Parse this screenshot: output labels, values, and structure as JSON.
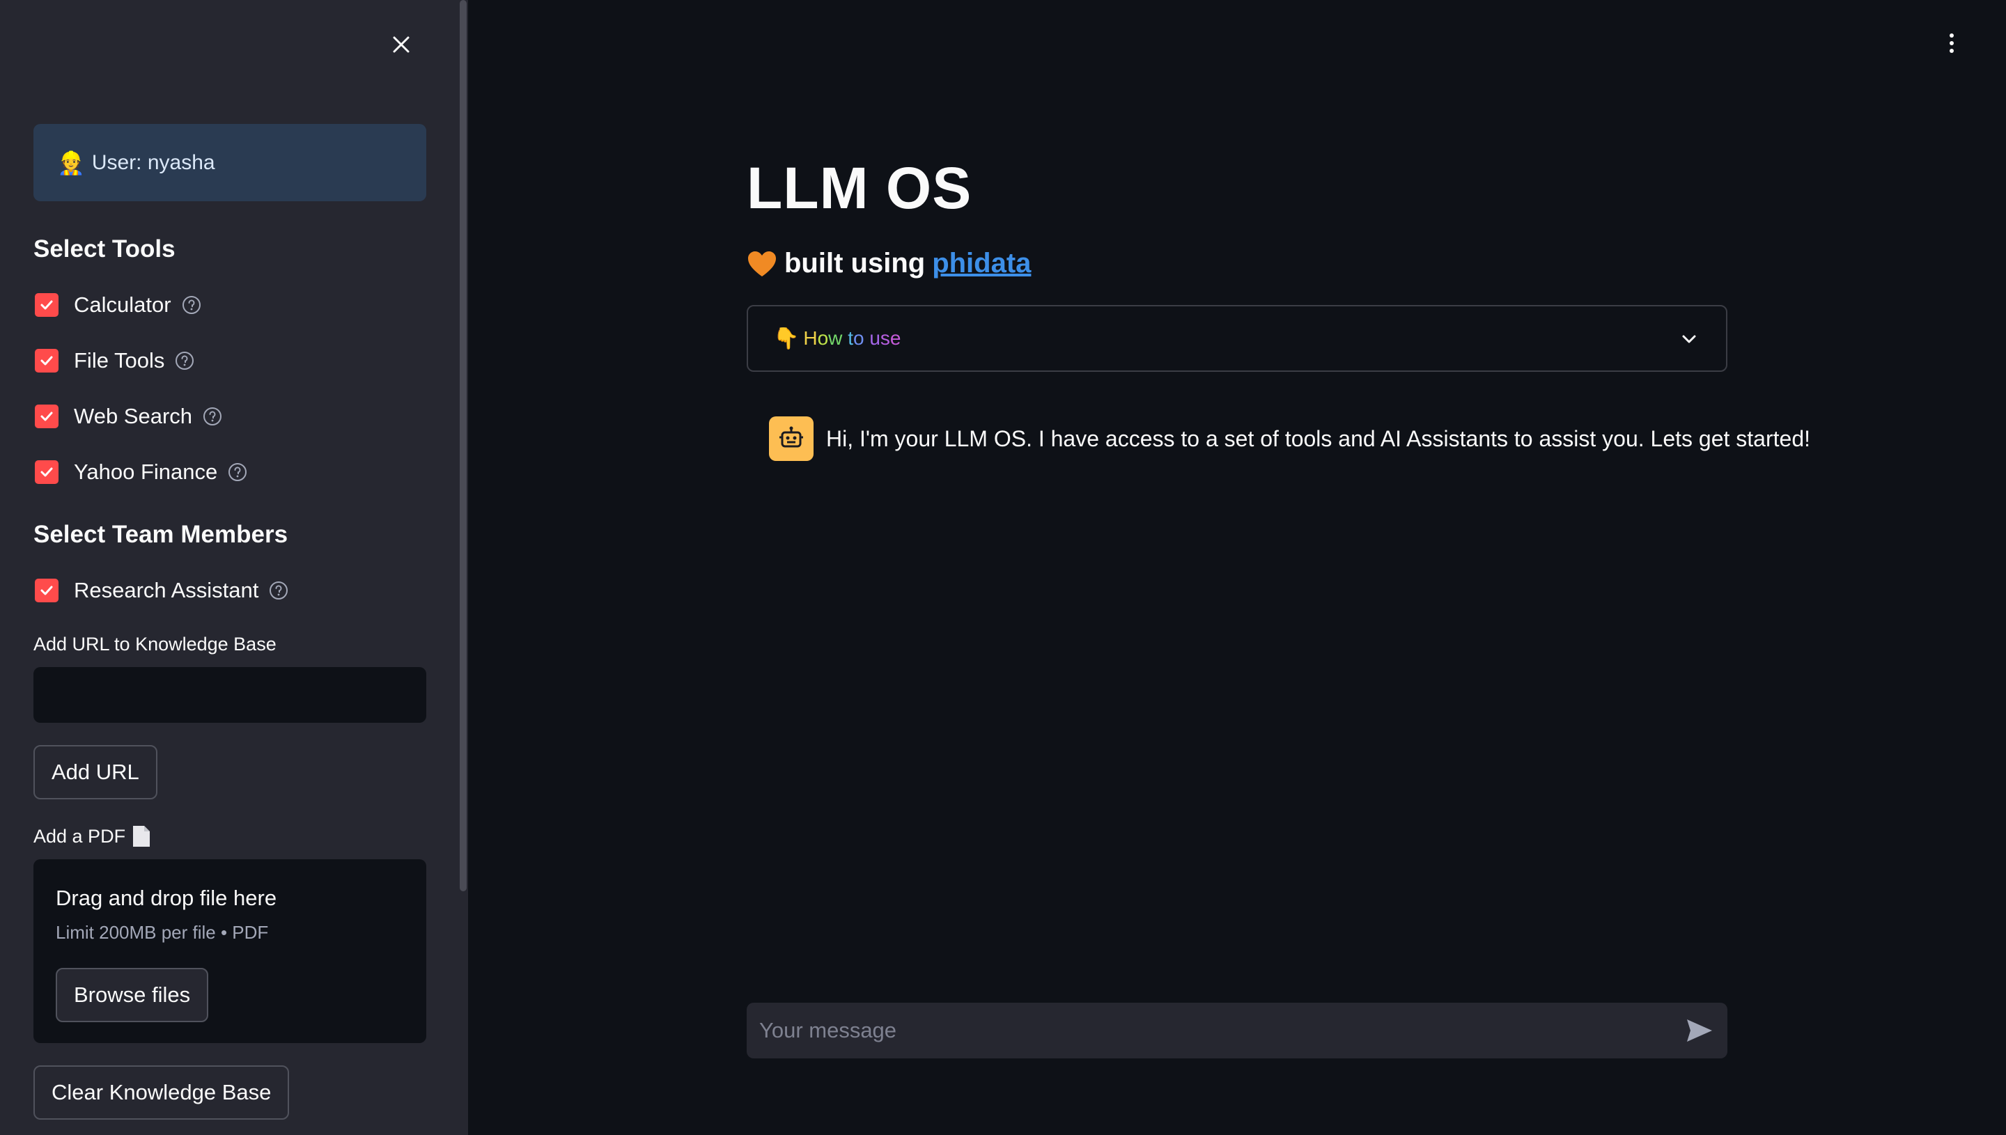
{
  "sidebar": {
    "user_emoji": "👷",
    "user_label": "User: nyasha",
    "tools_title": "Select Tools",
    "tools": [
      {
        "label": "Calculator",
        "checked": true
      },
      {
        "label": "File Tools",
        "checked": true
      },
      {
        "label": "Web Search",
        "checked": true
      },
      {
        "label": "Yahoo Finance",
        "checked": true
      }
    ],
    "team_title": "Select Team Members",
    "team": [
      {
        "label": "Research Assistant",
        "checked": true
      }
    ],
    "url_label": "Add URL to Knowledge Base",
    "url_value": "",
    "add_url_button": "Add URL",
    "pdf_label": "Add a PDF",
    "pdf_icon": "document-icon",
    "dropzone_title": "Drag and drop file here",
    "dropzone_limit": "Limit 200MB per file • PDF",
    "browse_button": "Browse files",
    "clear_button": "Clear Knowledge Base"
  },
  "main": {
    "title": "LLM OS",
    "subtitle_prefix": "built using",
    "subtitle_link": "phidata",
    "expander_emoji": "👇",
    "expander_label": "How to use",
    "message_text": "Hi, I'm your LLM OS. I have access to a set of tools and AI Assistants to assist you. Lets get started!",
    "chat_placeholder": "Your message"
  },
  "colors": {
    "accent": "#ff4b4b",
    "sidebar_bg": "#262730",
    "main_bg": "#0e1117",
    "link": "#3d8fe8",
    "bot_avatar": "#fdbe53",
    "heart": "#f08a24"
  }
}
